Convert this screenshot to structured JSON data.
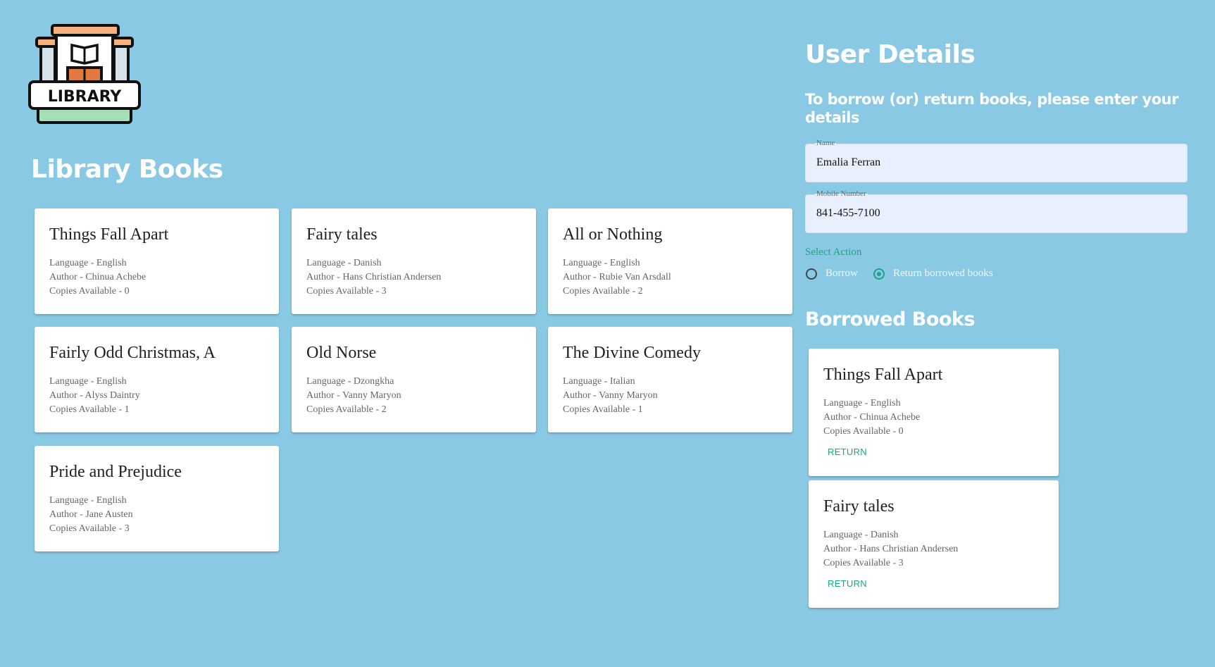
{
  "logo": {
    "text": "LIBRARY"
  },
  "library": {
    "title": "Library Books",
    "books": [
      {
        "title": "Things Fall Apart",
        "language": "Language - English",
        "author": "Author - Chinua Achebe",
        "copies": "Copies Available - 0"
      },
      {
        "title": "Fairy tales",
        "language": "Language - Danish",
        "author": "Author - Hans Christian Andersen",
        "copies": "Copies Available - 3"
      },
      {
        "title": "All or Nothing",
        "language": "Language - English",
        "author": "Author - Rubie Van Arsdall",
        "copies": "Copies Available - 2"
      },
      {
        "title": "Fairly Odd Christmas, A",
        "language": "Language - English",
        "author": "Author - Alyss Daintry",
        "copies": "Copies Available - 1"
      },
      {
        "title": "Old Norse",
        "language": "Language - Dzongkha",
        "author": "Author - Vanny Maryon",
        "copies": "Copies Available - 2"
      },
      {
        "title": "The Divine Comedy",
        "language": "Language - Italian",
        "author": "Author - Vanny Maryon",
        "copies": "Copies Available - 1"
      },
      {
        "title": "Pride and Prejudice",
        "language": "Language - English",
        "author": "Author - Jane Austen",
        "copies": "Copies Available - 3"
      }
    ]
  },
  "user": {
    "title": "User Details",
    "subtitle": "To borrow (or) return books, please enter your details",
    "name_label": "Name",
    "name_value": "Emalia Ferran",
    "mobile_label": "Mobile Number",
    "mobile_value": "841-455-7100",
    "select_action_label": "Select Action",
    "options": [
      {
        "label": "Borrow",
        "checked": false
      },
      {
        "label": "Return borrowed books",
        "checked": true
      }
    ]
  },
  "borrowed": {
    "title": "Borrowed Books",
    "return_label": "RETURN",
    "books": [
      {
        "title": "Things Fall Apart",
        "language": "Language - English",
        "author": "Author - Chinua Achebe",
        "copies": "Copies Available - 0"
      },
      {
        "title": "Fairy tales",
        "language": "Language - Danish",
        "author": "Author - Hans Christian Andersen",
        "copies": "Copies Available - 3"
      }
    ]
  },
  "colors": {
    "background": "#8ac9e4",
    "accent": "#18a67f",
    "field": "#e8f0fe"
  }
}
